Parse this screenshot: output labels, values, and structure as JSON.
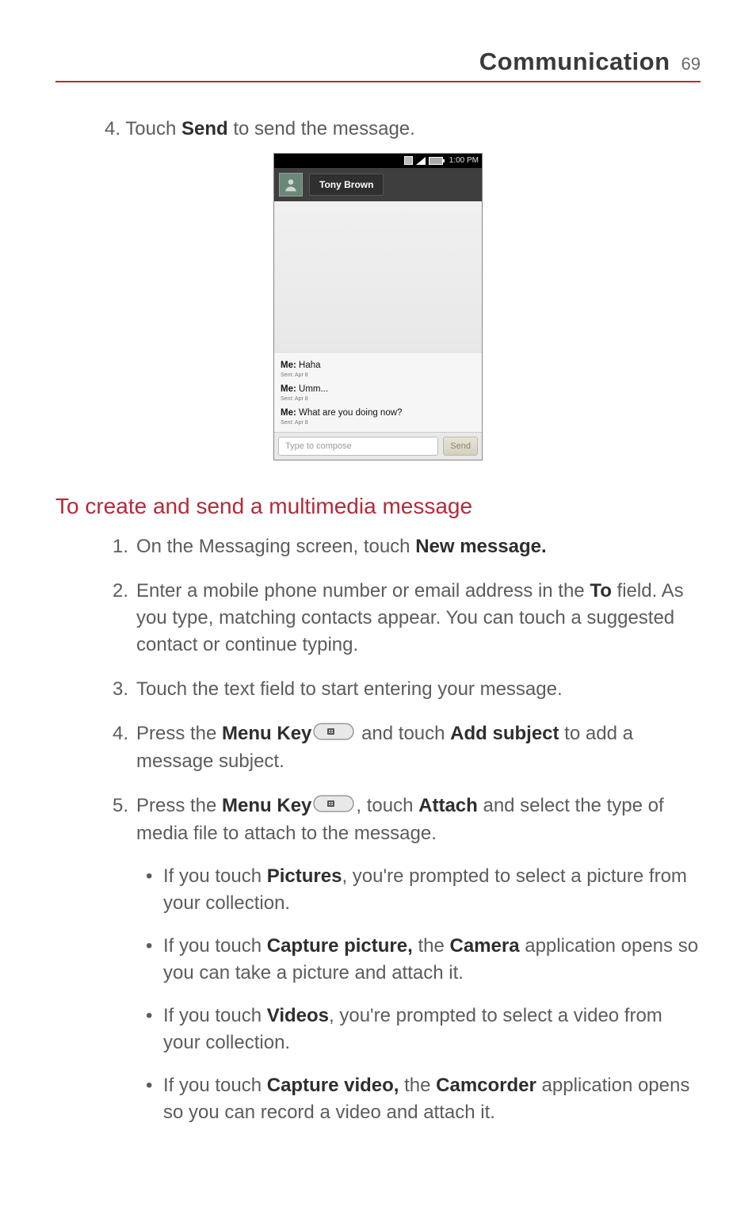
{
  "header": {
    "title": "Communication",
    "page_number": "69"
  },
  "above_shot": {
    "step4_prefix": "4. Touch ",
    "step4_bold": "Send",
    "step4_suffix": " to send the message."
  },
  "screenshot": {
    "status_time": "1:00 PM",
    "contact_name": "Tony Brown",
    "messages": [
      {
        "sender": "Me:",
        "text": " Haha",
        "time": "Sent: Apr 8"
      },
      {
        "sender": "Me:",
        "text": " Umm...",
        "time": "Sent: Apr 8"
      },
      {
        "sender": "Me:",
        "text": " What are you doing now?",
        "time": "Sent: Apr 8"
      }
    ],
    "compose_placeholder": "Type to compose",
    "send_label": "Send"
  },
  "section_heading": "To create and send a multimedia message",
  "steps": [
    {
      "parts": [
        {
          "t": "On the Messaging screen, touch "
        },
        {
          "t": "New message.",
          "b": true
        }
      ]
    },
    {
      "parts": [
        {
          "t": "Enter a mobile phone number or email address in the "
        },
        {
          "t": "To",
          "b": true
        },
        {
          "t": " field. As you type, matching contacts appear. You can touch a suggested contact or continue typing."
        }
      ]
    },
    {
      "parts": [
        {
          "t": "Touch the text field to start entering your message."
        }
      ]
    },
    {
      "parts": [
        {
          "t": "Press the "
        },
        {
          "t": "Menu Key",
          "b": true
        },
        {
          "t": " ",
          "icon": true
        },
        {
          "t": " and touch "
        },
        {
          "t": "Add subject",
          "b": true
        },
        {
          "t": " to add a message subject."
        }
      ]
    },
    {
      "parts": [
        {
          "t": "Press the "
        },
        {
          "t": "Menu Key",
          "b": true
        },
        {
          "t": " ",
          "icon": true
        },
        {
          "t": ", touch "
        },
        {
          "t": "Attach",
          "b": true
        },
        {
          "t": " and select the type of media file to attach to the message."
        }
      ],
      "sub": [
        {
          "parts": [
            {
              "t": "If you touch "
            },
            {
              "t": "Pictures",
              "b": true
            },
            {
              "t": ", you're prompted to select a picture from your collection."
            }
          ]
        },
        {
          "parts": [
            {
              "t": "If you touch "
            },
            {
              "t": "Capture picture,",
              "b": true
            },
            {
              "t": " the "
            },
            {
              "t": "Camera",
              "b": true
            },
            {
              "t": " application opens so you can take a picture and attach it."
            }
          ]
        },
        {
          "parts": [
            {
              "t": "If you touch "
            },
            {
              "t": "Videos",
              "b": true
            },
            {
              "t": ", you're prompted to select a video from your collection."
            }
          ]
        },
        {
          "parts": [
            {
              "t": "If you touch "
            },
            {
              "t": "Capture video,",
              "b": true
            },
            {
              "t": " the "
            },
            {
              "t": "Camcorder",
              "b": true
            },
            {
              "t": " application opens so you can record a video and attach it."
            }
          ]
        }
      ]
    }
  ]
}
